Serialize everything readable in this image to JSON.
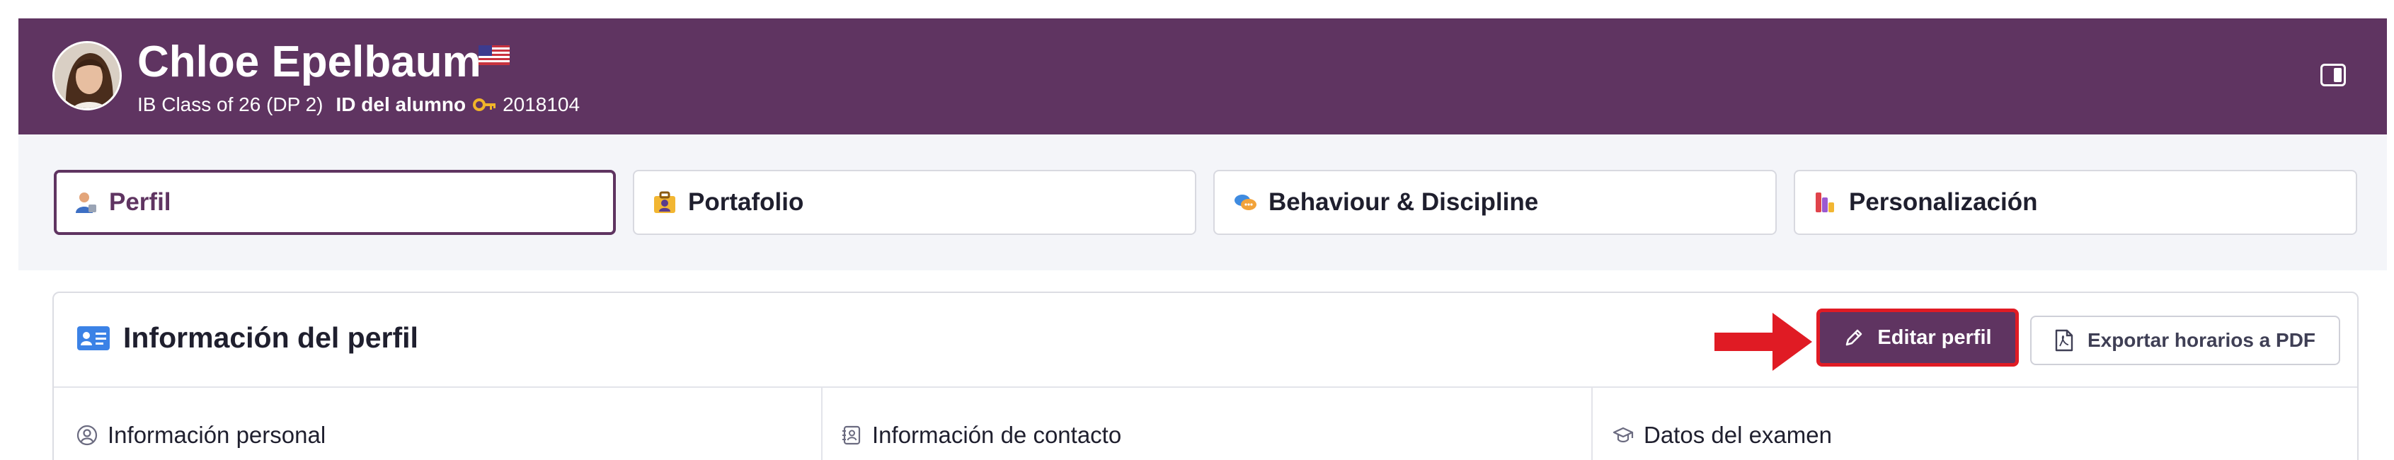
{
  "student": {
    "name": "Chloe Epelbaum",
    "class_label": "IB Class of 26 (DP 2)",
    "id_label": "ID del alumno",
    "id_value": "2018104"
  },
  "tabs": [
    {
      "label": "Perfil",
      "icon": "person-icon",
      "active": true
    },
    {
      "label": "Portafolio",
      "icon": "portfolio-icon",
      "active": false
    },
    {
      "label": "Behaviour & Discipline",
      "icon": "speech-bubbles-icon",
      "active": false
    },
    {
      "label": "Personalización",
      "icon": "palette-icon",
      "active": false
    }
  ],
  "profile": {
    "title": "Información del perfil",
    "edit_button": "Editar perfil",
    "export_button": "Exportar horarios a PDF",
    "sections": [
      {
        "title": "Información personal",
        "icon": "user-circle-icon"
      },
      {
        "title": "Información de contacto",
        "icon": "contact-book-icon"
      },
      {
        "title": "Datos del examen",
        "icon": "graduation-cap-icon"
      }
    ]
  },
  "colors": {
    "brand": "#5f3461",
    "highlight": "#e01b24",
    "page_bg": "#f4f5f9"
  }
}
